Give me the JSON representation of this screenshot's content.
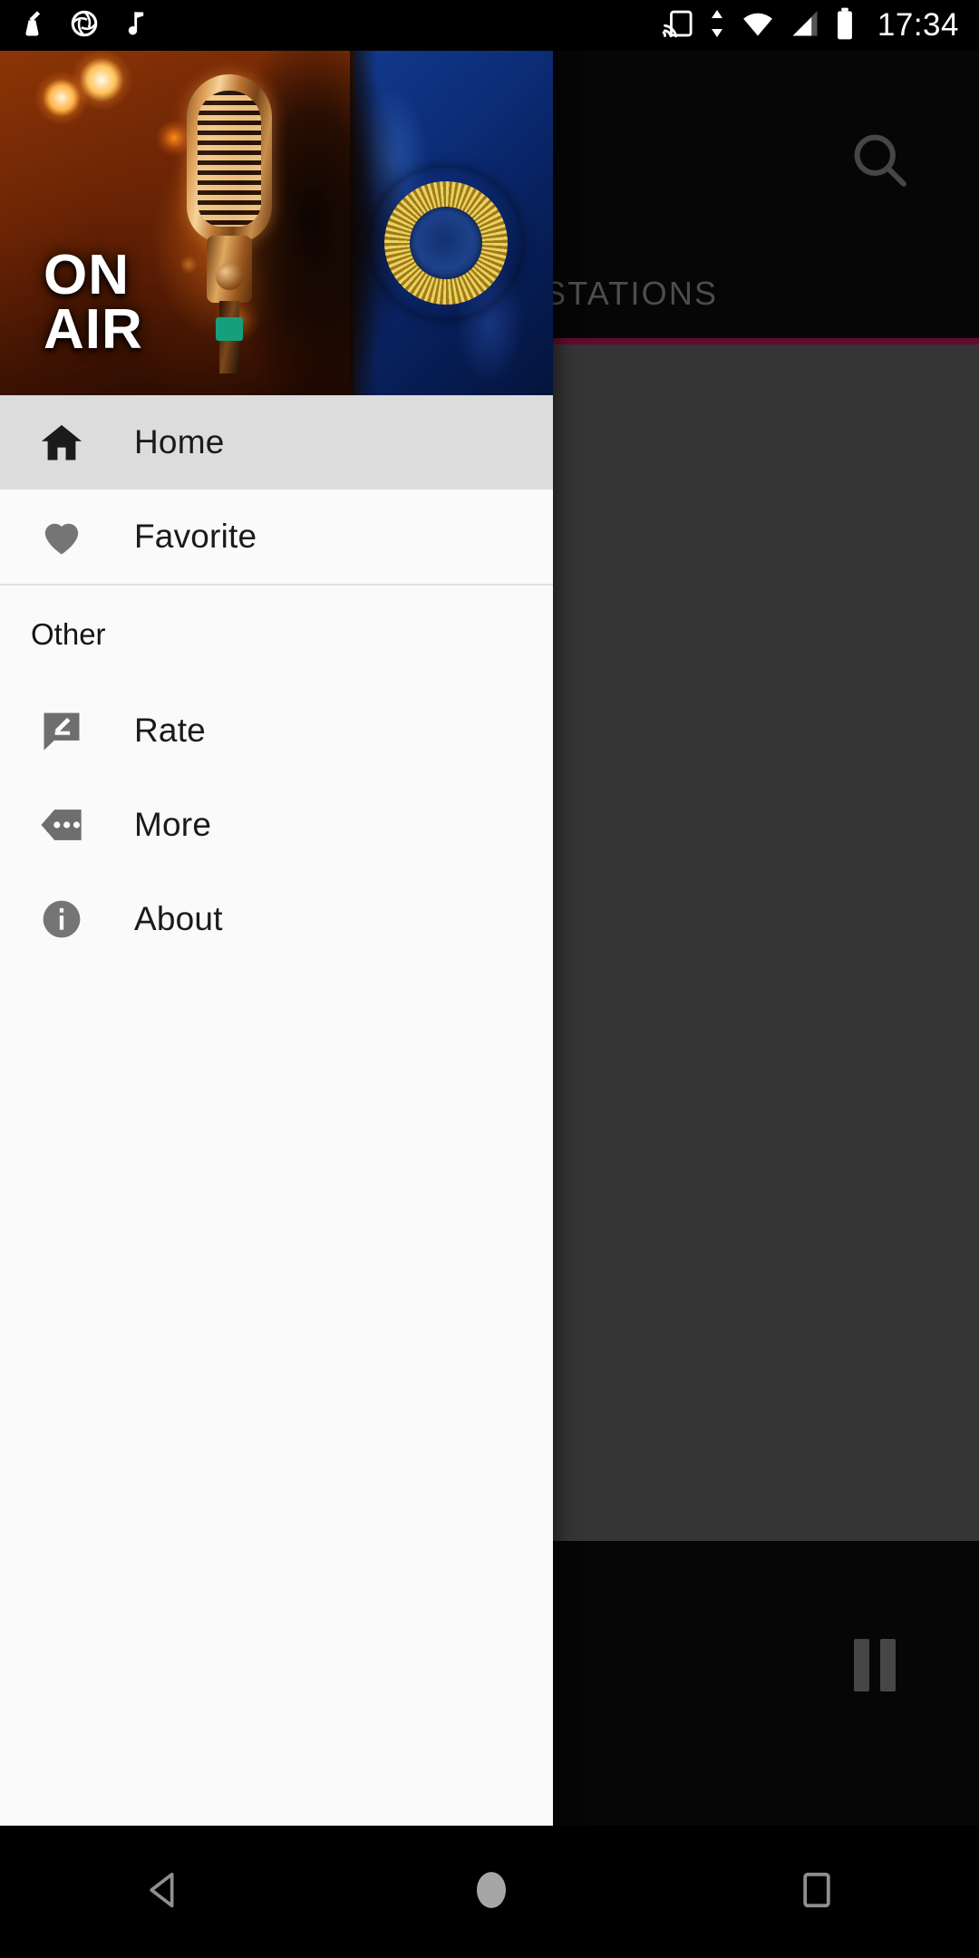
{
  "status_bar": {
    "time": "17:34",
    "left_icons": [
      {
        "name": "cleaner-icon",
        "label": "cleaner"
      },
      {
        "name": "camera-aperture-icon",
        "label": "camera"
      },
      {
        "name": "music-note-icon",
        "label": "music"
      }
    ],
    "right_icons": [
      {
        "name": "cast-icon",
        "label": "cast"
      },
      {
        "name": "vibrate-icon",
        "label": "vibrate"
      },
      {
        "name": "wifi-icon",
        "label": "wifi"
      },
      {
        "name": "signal-icon",
        "label": "signal"
      },
      {
        "name": "battery-icon",
        "label": "battery"
      }
    ]
  },
  "background_app": {
    "search_icon": "search-icon",
    "tab_label": "STATIONS",
    "tab_indicator_color": "#c2185b",
    "player": {
      "button_icon": "pause-icon",
      "button_label": "Pause"
    }
  },
  "drawer": {
    "header": {
      "on_air_line1": "ON",
      "on_air_line2": "AIR",
      "artwork_name": "on-air-microphone-georgia-flag"
    },
    "items": [
      {
        "id": "home",
        "label": "Home",
        "icon": "home-icon",
        "selected": true
      },
      {
        "id": "favorite",
        "label": "Favorite",
        "icon": "heart-icon",
        "selected": false
      }
    ],
    "section_other": {
      "title": "Other",
      "items": [
        {
          "id": "rate",
          "label": "Rate",
          "icon": "rate-review-icon"
        },
        {
          "id": "more",
          "label": "More",
          "icon": "more-horizontal-icon"
        },
        {
          "id": "about",
          "label": "About",
          "icon": "info-circle-icon"
        }
      ]
    }
  },
  "navigation_bar": {
    "back": "back-icon",
    "home": "home-circle-icon",
    "recents": "recents-square-icon"
  },
  "colors": {
    "drawer_background": "#fafafa",
    "selected_row": "#dcdcdc",
    "icon_gray": "#757575",
    "accent": "#c2185b"
  }
}
